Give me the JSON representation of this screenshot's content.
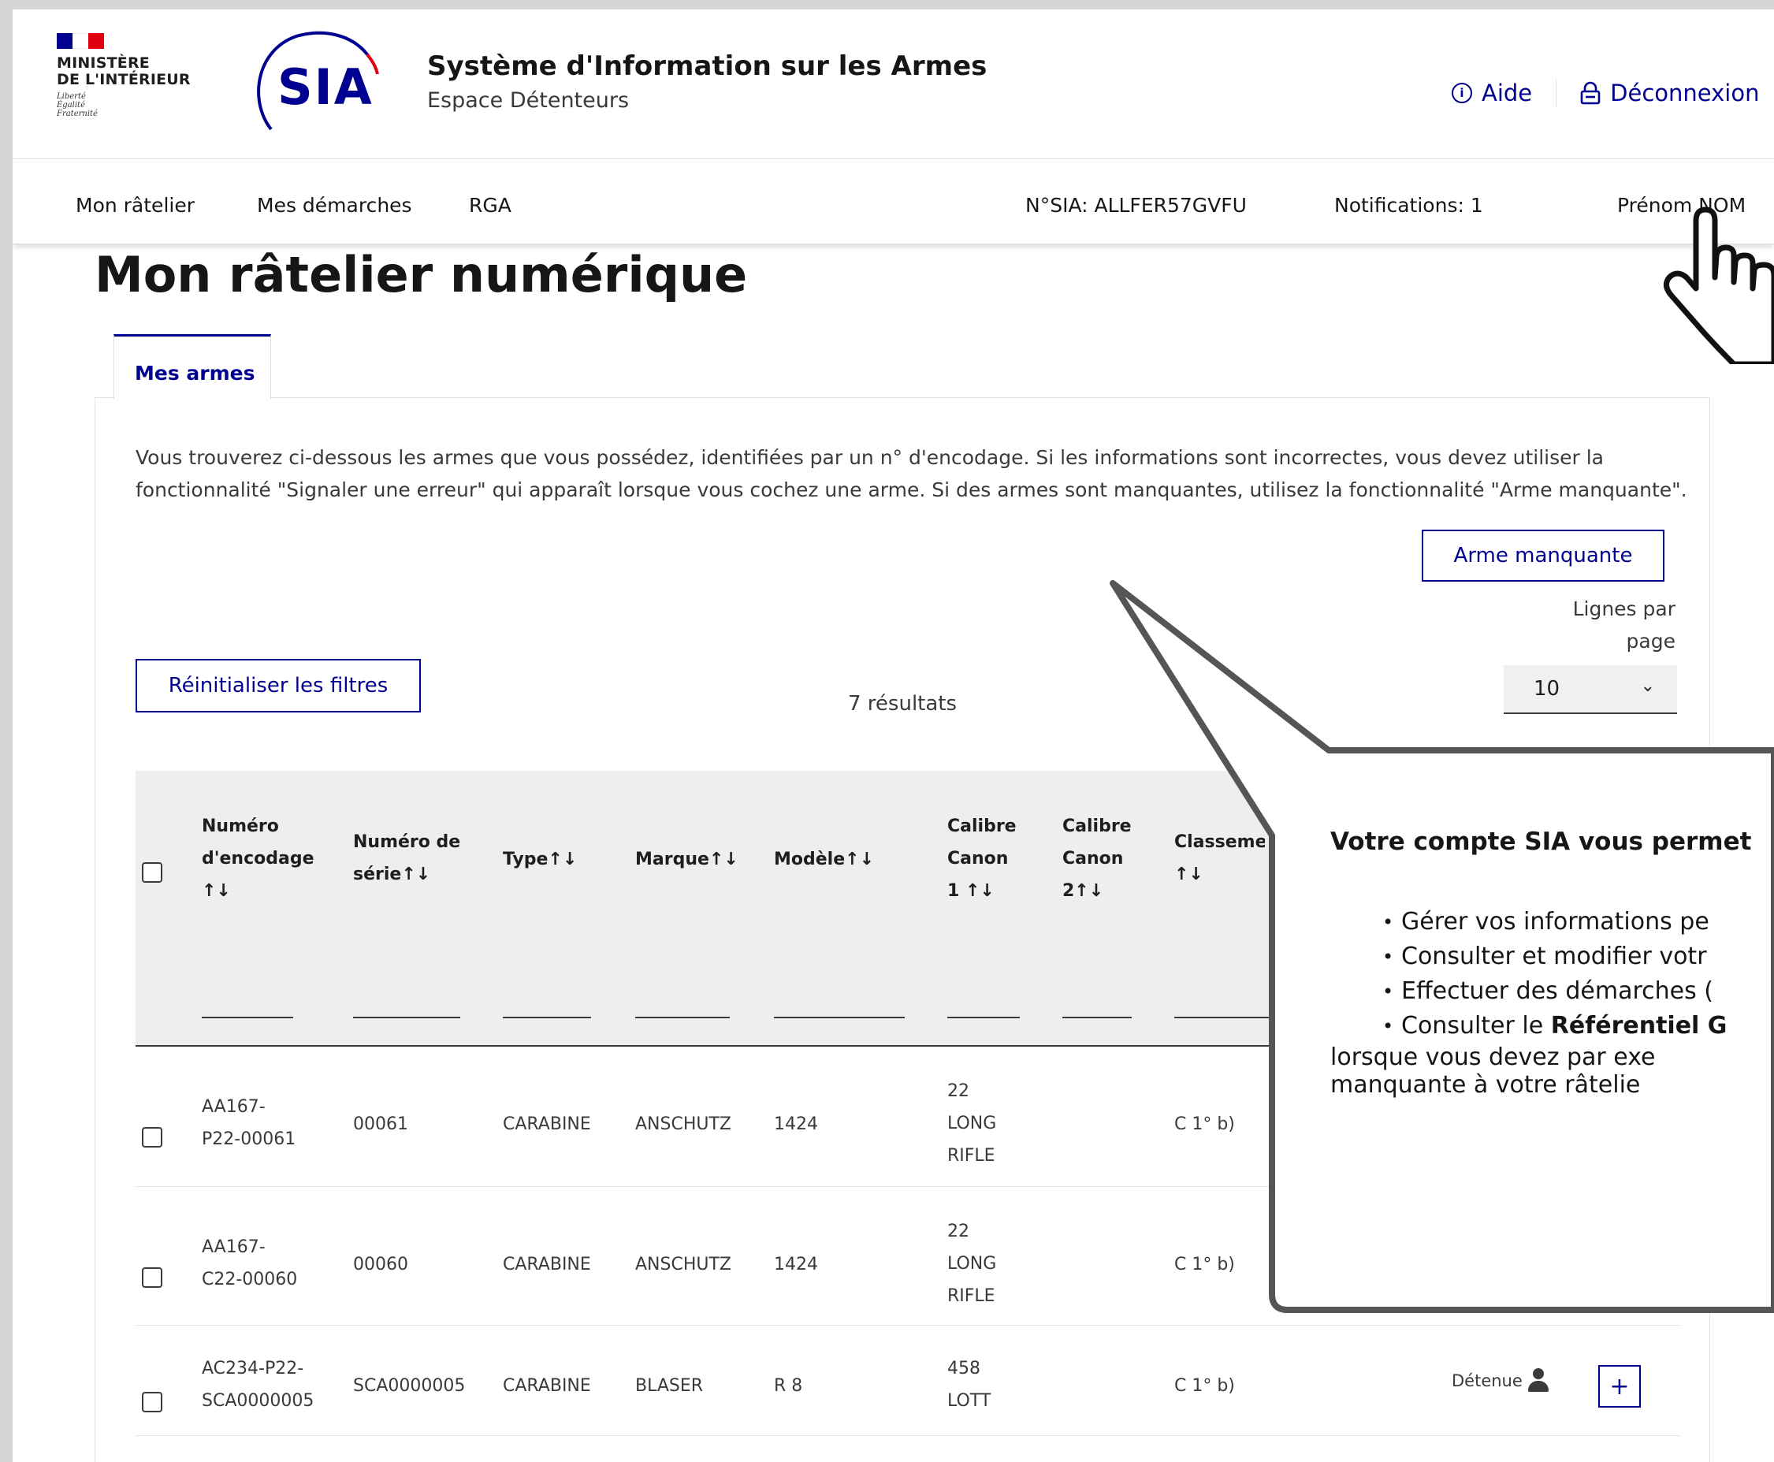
{
  "header": {
    "ministry_name": "Ministère\nde l'Intérieur",
    "devise": "Liberté\nÉgalité\nFraternité",
    "logo_text": "SIA",
    "site_title": "Système d'Information sur les Armes",
    "site_subtitle": "Espace Détenteurs",
    "help_label": "Aide",
    "logout_label": "Déconnexion"
  },
  "nav": {
    "items": [
      "Mon râtelier",
      "Mes démarches",
      "RGA"
    ],
    "sia_number": "N°SIA: ALLFER57GVFU",
    "notifications": "Notifications: 1",
    "user_name": "Prénom NOM"
  },
  "main": {
    "title": "Mon râtelier numérique",
    "tab_label": "Mes armes",
    "intro": "Vous trouverez ci-dessous les armes que vous possédez, identifiées par un n° d'encodage. Si les informations sont incorrectes, vous devez utiliser la fonctionnalité \"Signaler une erreur\" qui apparaît lorsque vous cochez une arme. Si des armes sont manquantes, utilisez la fonctionnalité \"Arme manquante\".",
    "missing_weapon_button": "Arme manquante",
    "lines_per_page_label": "Lignes par page",
    "lines_per_page_value": "10",
    "reset_filters_button": "Réinitialiser les filtres",
    "results_count": "7 résultats"
  },
  "table": {
    "headers": [
      "Numéro d'encodage ↑↓",
      "Numéro de série↑↓",
      "Type↑↓",
      "Marque↑↓",
      "Modèle↑↓",
      "Calibre Canon 1 ↑↓",
      "Calibre Canon 2↑↓",
      "Classemen ↑↓"
    ],
    "rows": [
      {
        "encodage": "AA167-\nP22-00061",
        "serie": "00061",
        "type": "CARABINE",
        "marque": "ANSCHUTZ",
        "modele": "1424",
        "calibre1": "22\nLONG\nRIFLE",
        "calibre2": "",
        "classement": "C 1° b)"
      },
      {
        "encodage": "AA167-\nC22-00060",
        "serie": "00060",
        "type": "CARABINE",
        "marque": "ANSCHUTZ",
        "modele": "1424",
        "calibre1": "22\nLONG\nRIFLE",
        "calibre2": "",
        "classement": "C 1° b)"
      },
      {
        "encodage": "AC234-P22-\nSCA0000005",
        "serie": "SCA0000005",
        "type": "CARABINE",
        "marque": "BLASER",
        "modele": "R 8",
        "calibre1": "458\nLOTT",
        "calibre2": "",
        "classement": "C 1° b)",
        "status": "Détenue",
        "action": "+"
      }
    ]
  },
  "callout": {
    "title": "Votre compte SIA vous permet",
    "items": [
      "Gérer vos informations pe",
      "Consulter et modifier votr",
      "Effectuer des démarches (",
      "Consulter le "
    ],
    "rga_bold": "Référentiel G",
    "item4_cont1": "lorsque vous devez par exe",
    "item4_cont2": "manquante à votre râtelie"
  },
  "colors": {
    "primary_blue": "#000091",
    "flag_red": "#e1000f",
    "callout_border": "#555555"
  }
}
